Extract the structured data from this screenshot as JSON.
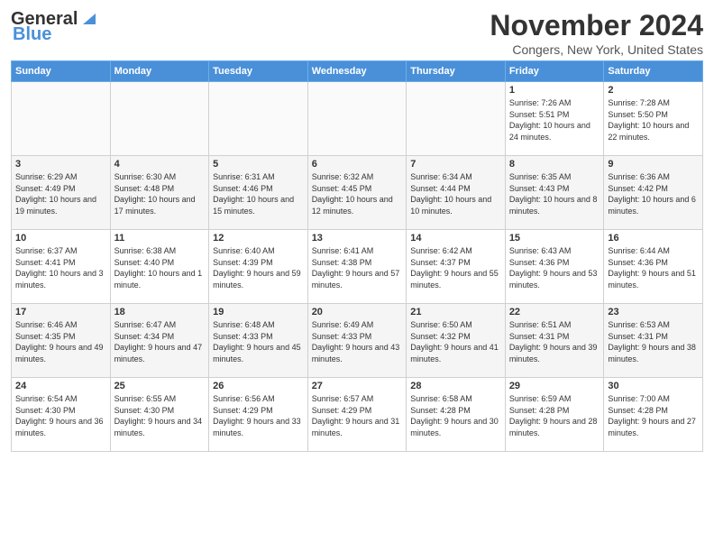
{
  "header": {
    "logo_general": "General",
    "logo_blue": "Blue",
    "month": "November 2024",
    "location": "Congers, New York, United States"
  },
  "days_of_week": [
    "Sunday",
    "Monday",
    "Tuesday",
    "Wednesday",
    "Thursday",
    "Friday",
    "Saturday"
  ],
  "weeks": [
    [
      {
        "day": "",
        "info": ""
      },
      {
        "day": "",
        "info": ""
      },
      {
        "day": "",
        "info": ""
      },
      {
        "day": "",
        "info": ""
      },
      {
        "day": "",
        "info": ""
      },
      {
        "day": "1",
        "info": "Sunrise: 7:26 AM\nSunset: 5:51 PM\nDaylight: 10 hours and 24 minutes."
      },
      {
        "day": "2",
        "info": "Sunrise: 7:28 AM\nSunset: 5:50 PM\nDaylight: 10 hours and 22 minutes."
      }
    ],
    [
      {
        "day": "3",
        "info": "Sunrise: 6:29 AM\nSunset: 4:49 PM\nDaylight: 10 hours and 19 minutes."
      },
      {
        "day": "4",
        "info": "Sunrise: 6:30 AM\nSunset: 4:48 PM\nDaylight: 10 hours and 17 minutes."
      },
      {
        "day": "5",
        "info": "Sunrise: 6:31 AM\nSunset: 4:46 PM\nDaylight: 10 hours and 15 minutes."
      },
      {
        "day": "6",
        "info": "Sunrise: 6:32 AM\nSunset: 4:45 PM\nDaylight: 10 hours and 12 minutes."
      },
      {
        "day": "7",
        "info": "Sunrise: 6:34 AM\nSunset: 4:44 PM\nDaylight: 10 hours and 10 minutes."
      },
      {
        "day": "8",
        "info": "Sunrise: 6:35 AM\nSunset: 4:43 PM\nDaylight: 10 hours and 8 minutes."
      },
      {
        "day": "9",
        "info": "Sunrise: 6:36 AM\nSunset: 4:42 PM\nDaylight: 10 hours and 6 minutes."
      }
    ],
    [
      {
        "day": "10",
        "info": "Sunrise: 6:37 AM\nSunset: 4:41 PM\nDaylight: 10 hours and 3 minutes."
      },
      {
        "day": "11",
        "info": "Sunrise: 6:38 AM\nSunset: 4:40 PM\nDaylight: 10 hours and 1 minute."
      },
      {
        "day": "12",
        "info": "Sunrise: 6:40 AM\nSunset: 4:39 PM\nDaylight: 9 hours and 59 minutes."
      },
      {
        "day": "13",
        "info": "Sunrise: 6:41 AM\nSunset: 4:38 PM\nDaylight: 9 hours and 57 minutes."
      },
      {
        "day": "14",
        "info": "Sunrise: 6:42 AM\nSunset: 4:37 PM\nDaylight: 9 hours and 55 minutes."
      },
      {
        "day": "15",
        "info": "Sunrise: 6:43 AM\nSunset: 4:36 PM\nDaylight: 9 hours and 53 minutes."
      },
      {
        "day": "16",
        "info": "Sunrise: 6:44 AM\nSunset: 4:36 PM\nDaylight: 9 hours and 51 minutes."
      }
    ],
    [
      {
        "day": "17",
        "info": "Sunrise: 6:46 AM\nSunset: 4:35 PM\nDaylight: 9 hours and 49 minutes."
      },
      {
        "day": "18",
        "info": "Sunrise: 6:47 AM\nSunset: 4:34 PM\nDaylight: 9 hours and 47 minutes."
      },
      {
        "day": "19",
        "info": "Sunrise: 6:48 AM\nSunset: 4:33 PM\nDaylight: 9 hours and 45 minutes."
      },
      {
        "day": "20",
        "info": "Sunrise: 6:49 AM\nSunset: 4:33 PM\nDaylight: 9 hours and 43 minutes."
      },
      {
        "day": "21",
        "info": "Sunrise: 6:50 AM\nSunset: 4:32 PM\nDaylight: 9 hours and 41 minutes."
      },
      {
        "day": "22",
        "info": "Sunrise: 6:51 AM\nSunset: 4:31 PM\nDaylight: 9 hours and 39 minutes."
      },
      {
        "day": "23",
        "info": "Sunrise: 6:53 AM\nSunset: 4:31 PM\nDaylight: 9 hours and 38 minutes."
      }
    ],
    [
      {
        "day": "24",
        "info": "Sunrise: 6:54 AM\nSunset: 4:30 PM\nDaylight: 9 hours and 36 minutes."
      },
      {
        "day": "25",
        "info": "Sunrise: 6:55 AM\nSunset: 4:30 PM\nDaylight: 9 hours and 34 minutes."
      },
      {
        "day": "26",
        "info": "Sunrise: 6:56 AM\nSunset: 4:29 PM\nDaylight: 9 hours and 33 minutes."
      },
      {
        "day": "27",
        "info": "Sunrise: 6:57 AM\nSunset: 4:29 PM\nDaylight: 9 hours and 31 minutes."
      },
      {
        "day": "28",
        "info": "Sunrise: 6:58 AM\nSunset: 4:28 PM\nDaylight: 9 hours and 30 minutes."
      },
      {
        "day": "29",
        "info": "Sunrise: 6:59 AM\nSunset: 4:28 PM\nDaylight: 9 hours and 28 minutes."
      },
      {
        "day": "30",
        "info": "Sunrise: 7:00 AM\nSunset: 4:28 PM\nDaylight: 9 hours and 27 minutes."
      }
    ]
  ]
}
